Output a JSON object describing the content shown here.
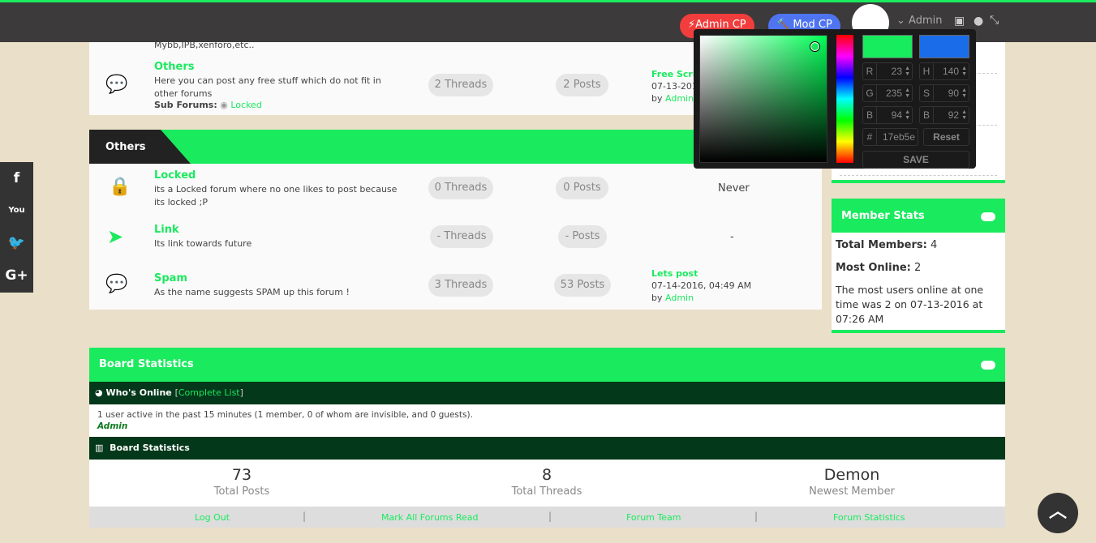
{
  "topbar": {
    "admin_cp": "Admin CP",
    "mod_cp": "Mod CP",
    "username": "Admin"
  },
  "forums_top": {
    "partial_desc": "Mybb,IPB,xenforo,etc..",
    "others": {
      "title": "Others",
      "desc": "Here you can post any free stuff which do not fit in other forums",
      "sub_label": "Sub Forums:",
      "sub_link": "Locked",
      "threads": "2 Threads",
      "posts": "2 Posts",
      "last_title": "Free Scripts",
      "last_date": "07-13-2016",
      "last_by": "by",
      "last_user": "Admin"
    }
  },
  "category": {
    "title": "Others",
    "forums": [
      {
        "title": "Locked",
        "desc": "its a Locked forum where no one likes to post because its locked ;P",
        "threads": "0 Threads",
        "posts": "0 Posts",
        "last": "Never",
        "icon": "lock-icon"
      },
      {
        "title": "Link",
        "desc": "Its link towards future",
        "threads": "- Threads",
        "posts": "- Posts",
        "last": "-",
        "icon": "location-arrow-icon"
      },
      {
        "title": "Spam",
        "desc": "As the name suggests SPAM up this forum !",
        "threads": "3 Threads",
        "posts": "53 Posts",
        "last_title": "Lets post",
        "last_date": "07-14-2016, 04:49 AM",
        "last_by": "by",
        "last_user": "Admin",
        "icon": "comments-icon"
      }
    ]
  },
  "member_stats": {
    "title": "Member Stats",
    "total_label": "Total Members:",
    "total": "4",
    "most_label": "Most Online:",
    "most": "2",
    "text": "The most users online at one time was 2 on 07-13-2016 at 07:26 AM"
  },
  "board": {
    "title": "Board Statistics",
    "whos_online": "Who's Online",
    "complete_list": "Complete List",
    "active_text": "1 user active in the past 15 minutes (1 member, 0 of whom are invisible, and 0 guests).",
    "online_user": "Admin",
    "stats_title": "Board Statistics",
    "stats": [
      {
        "value": "73",
        "label": "Total Posts"
      },
      {
        "value": "8",
        "label": "Total Threads"
      },
      {
        "value": "Demon",
        "label": "Newest Member"
      }
    ],
    "links": [
      "Log Out",
      "Mark All Forums Read",
      "Forum Team",
      "Forum Statistics"
    ]
  },
  "color_picker": {
    "r": "23",
    "g": "235",
    "b": "94",
    "h": "140",
    "s": "90",
    "bv": "92",
    "hex": "17eb5e",
    "reset": "Reset",
    "save": "SAVE",
    "current": "#17eb5e",
    "previous": "#1a6ce8"
  },
  "colors": {
    "accent": "#1aea5e",
    "dark_header": "#04381a",
    "topbar": "#3c3a3a"
  }
}
